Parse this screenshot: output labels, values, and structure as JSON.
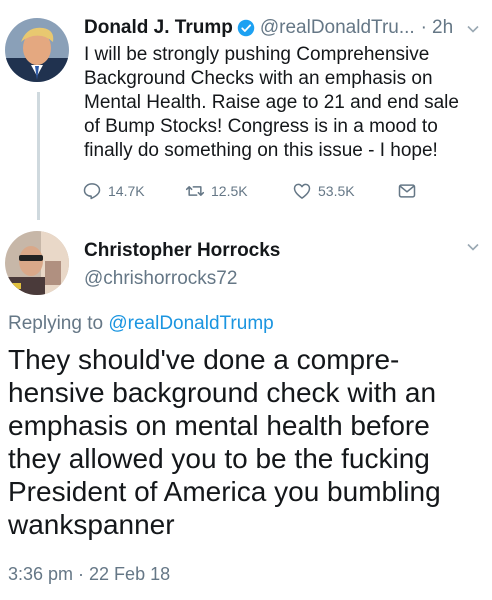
{
  "tweet": {
    "author_name": "Donald J. Trump",
    "handle": "@realDonaldTru...",
    "separator": "·",
    "time_ago": "2h",
    "text": "I will be strongly pushing Comprehensive Background Checks with an emphasis on Mental Health. Raise age to 21 and end sale of Bump Stocks! Congress is in a mood to finally do something on this issue - I hope!",
    "actions": {
      "reply_count": "14.7K",
      "retweet_count": "12.5K",
      "like_count": "53.5K"
    },
    "icons": [
      "verified-badge-icon",
      "chevron-down-icon",
      "reply-icon",
      "retweet-icon",
      "like-icon",
      "message-icon"
    ]
  },
  "reply": {
    "author_name": "Christopher Horrocks",
    "handle": "@chrishorrocks72",
    "replying_to_prefix": "Replying to",
    "replying_to_handle": "@realDonaldTrump",
    "text": "They should've done a compre-hensive background check with an emphasis on mental health before they allowed you to be the fucking President of America you bumbling wankspanner",
    "timestamp": "3:36 pm · 22 Feb 18"
  },
  "colors": {
    "text": "#14171a",
    "muted": "#657786",
    "link": "#1b95e0",
    "verified": "#1da1f2",
    "thread_line": "#cfd9de"
  }
}
